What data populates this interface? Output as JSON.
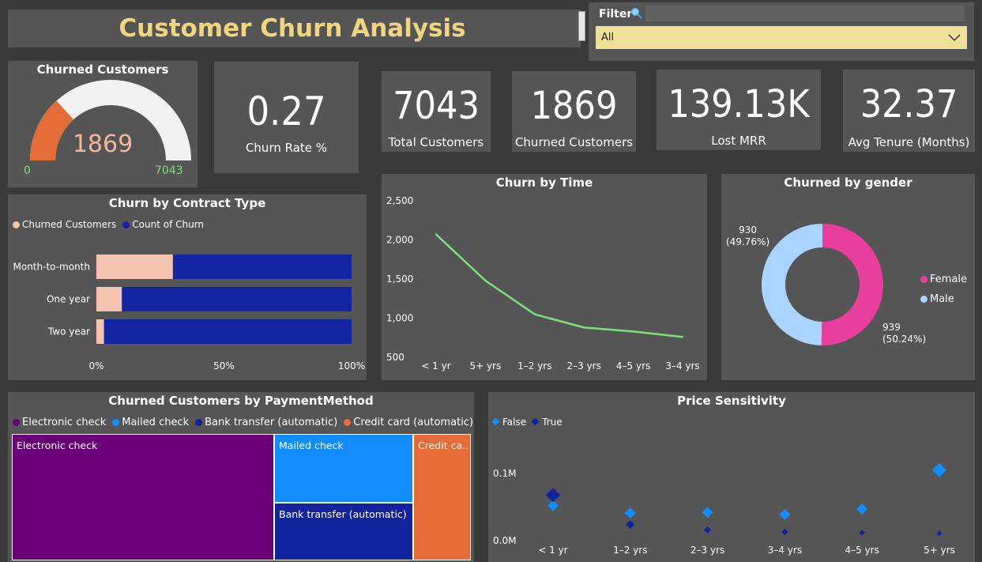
{
  "header": {
    "title": "Customer Churn Analysis"
  },
  "filter": {
    "label": "Filter",
    "selected": "All"
  },
  "kpis": {
    "gauge": {
      "title": "Churned Customers",
      "value": "1869",
      "min": "0",
      "max": "7043",
      "value_num": 1869,
      "max_num": 7043
    },
    "churn_rate": {
      "value": "0.27",
      "label": "Churn Rate %"
    },
    "total_customers": {
      "value": "7043",
      "label": "Total Customers"
    },
    "churned_customers": {
      "value": "1869",
      "label": "Churned Customers"
    },
    "lost_mrr": {
      "value": "139.13K",
      "label": "Lost MRR"
    },
    "avg_tenure": {
      "value": "32.37",
      "label": "Avg Tenure (Months)"
    }
  },
  "colors": {
    "gauge_fill": "#e46c37",
    "gauge_track": "#f2f2f2",
    "gauge_minmax": "#7be07b",
    "churned": "#f4c3b0",
    "count": "#1325a0",
    "line": "#7be07b",
    "female": "#e83e9e",
    "male": "#a9d4ff",
    "electronic": "#6a0078",
    "mailed": "#118dff",
    "bank": "#12239e",
    "credit": "#e66c37",
    "ps_false": "#118dff",
    "ps_true": "#12239e"
  },
  "chart_data": [
    {
      "type": "bar",
      "title": "Churn by Contract Type",
      "legend": [
        "Churned Customers",
        "Count of Churn"
      ],
      "categories": [
        "Month-to-month",
        "One year",
        "Two year"
      ],
      "stacked_percent": true,
      "series": [
        {
          "name": "Churned Customers",
          "values": [
            30,
            10,
            3
          ]
        },
        {
          "name": "Count of Churn",
          "values": [
            70,
            90,
            97
          ]
        }
      ],
      "xticks": [
        "0%",
        "50%",
        "100%"
      ]
    },
    {
      "type": "line",
      "title": "Churn by Time",
      "x": [
        "< 1 yr",
        "5+ yrs",
        "1–2 yrs",
        "2–3 yrs",
        "4–5 yrs",
        "3–4 yrs"
      ],
      "values": [
        2070,
        1480,
        1050,
        880,
        830,
        760
      ],
      "ylim": [
        500,
        2500
      ],
      "yticks": [
        "2,500",
        "2,000",
        "1,500",
        "1,000",
        "500"
      ]
    },
    {
      "type": "pie",
      "title": "Churned by gender",
      "legend": [
        "Female",
        "Male"
      ],
      "slices": [
        {
          "name": "Female",
          "value": 939,
          "label": "939",
          "pct": "(50.24%)"
        },
        {
          "name": "Male",
          "value": 930,
          "label": "930",
          "pct": "(49.76%)"
        }
      ]
    },
    {
      "type": "heatmap",
      "title": "Churned Customers by PaymentMethod",
      "legend": [
        "Electronic check",
        "Mailed check",
        "Bank transfer (automatic)",
        "Credit card (automatic)"
      ],
      "items": [
        {
          "name": "Electronic check",
          "label": "Electronic check",
          "value": 1071
        },
        {
          "name": "Mailed check",
          "label": "Mailed check",
          "value": 308
        },
        {
          "name": "Bank transfer (automatic)",
          "label": "Bank transfer (automatic)",
          "value": 258
        },
        {
          "name": "Credit card (automatic)",
          "label": "Credit ca...",
          "value": 232
        }
      ]
    },
    {
      "type": "scatter",
      "title": "Price Sensitivity",
      "legend": [
        "False",
        "True"
      ],
      "categories": [
        "< 1 yr",
        "1–2 yrs",
        "2–3 yrs",
        "3–4 yrs",
        "4–5 yrs",
        "5+ yrs"
      ],
      "ylim": [
        0,
        0.1
      ],
      "yticks": [
        "0.1M",
        "0.0M"
      ],
      "series": [
        {
          "name": "False",
          "values": [
            0.052,
            0.041,
            0.042,
            0.039,
            0.047,
            0.105
          ],
          "size": [
            1,
            1,
            1,
            1,
            1,
            1.3
          ]
        },
        {
          "name": "True",
          "values": [
            0.068,
            0.024,
            0.016,
            0.013,
            0.012,
            0.011
          ],
          "size": [
            1.3,
            0.8,
            0.65,
            0.6,
            0.55,
            0.5
          ]
        }
      ]
    }
  ]
}
